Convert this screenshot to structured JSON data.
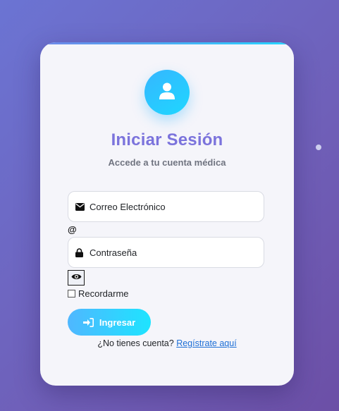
{
  "login": {
    "title": "Iniciar Sesión",
    "subtitle": "Accede a tu cuenta médica",
    "email": {
      "label": "Correo Electrónico",
      "icon": "envelope-icon",
      "suffix": "@"
    },
    "password": {
      "label": "Contraseña",
      "icon": "lock-icon",
      "toggle_icon": "eye-icon"
    },
    "remember": {
      "label": "Recordarme",
      "checked": false
    },
    "submit": {
      "label": "Ingresar",
      "icon": "sign-in-icon"
    },
    "signup": {
      "prompt": "¿No tienes cuenta?",
      "link": "Regístrate aquí"
    }
  },
  "colors": {
    "background_start": "#6b74d3",
    "background_end": "#6c4fa6",
    "accent_title": "#7b73dc",
    "accent_cyan": "#1ed7ff",
    "link": "#1d6fd6"
  }
}
